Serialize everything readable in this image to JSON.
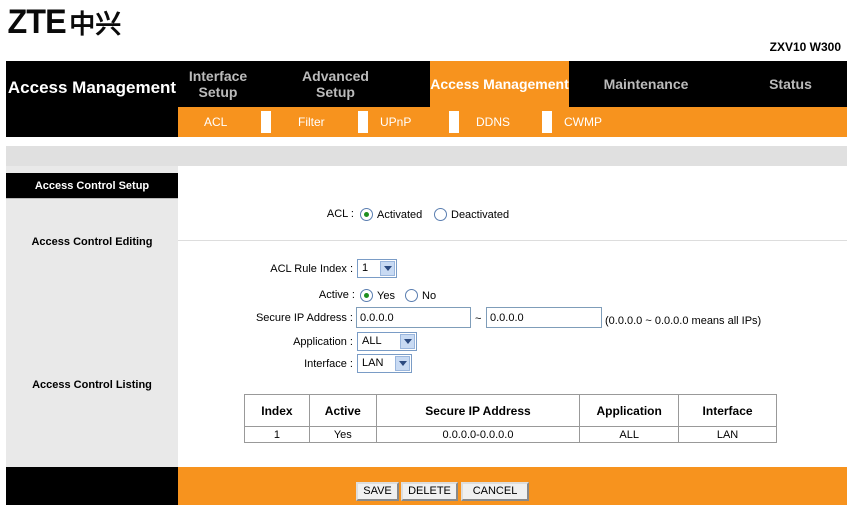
{
  "brand": {
    "logo_latin": "ZTE",
    "logo_cn": "中兴",
    "model": "ZXV10 W300"
  },
  "nav": {
    "section_title": "Access Management",
    "tabs": [
      {
        "label": "Interface Setup"
      },
      {
        "label": "Advanced Setup"
      },
      {
        "label": "Access Management",
        "active": true
      },
      {
        "label": "Maintenance"
      },
      {
        "label": "Status"
      }
    ],
    "subtabs": [
      "ACL",
      "Filter",
      "UPnP",
      "DDNS",
      "CWMP"
    ]
  },
  "sections": {
    "setup": "Access Control Setup",
    "editing": "Access Control Editing",
    "listing": "Access Control Listing"
  },
  "acl": {
    "label": "ACL :",
    "activated": "Activated",
    "deactivated": "Deactivated",
    "selected": "Activated"
  },
  "editing": {
    "rule_index_label": "ACL Rule Index :",
    "rule_index_value": "1",
    "active_label": "Active :",
    "yes": "Yes",
    "no": "No",
    "active_selected": "Yes",
    "ip_label": "Secure IP Address :",
    "ip_start": "0.0.0.0",
    "ip_sep": "~",
    "ip_end": "0.0.0.0",
    "ip_hint": "(0.0.0.0 ~ 0.0.0.0 means all IPs)",
    "application_label": "Application :",
    "application_value": "ALL",
    "interface_label": "Interface :",
    "interface_value": "LAN"
  },
  "table": {
    "headers": [
      "Index",
      "Active",
      "Secure IP Address",
      "Application",
      "Interface"
    ],
    "rows": [
      [
        "1",
        "Yes",
        "0.0.0.0-0.0.0.0",
        "ALL",
        "LAN"
      ]
    ]
  },
  "buttons": {
    "save": "SAVE",
    "delete": "DELETE",
    "cancel": "CANCEL"
  },
  "colors": {
    "accent": "#f7931e",
    "nav_bg": "#000000",
    "panel_bg": "#e9e9e9"
  }
}
